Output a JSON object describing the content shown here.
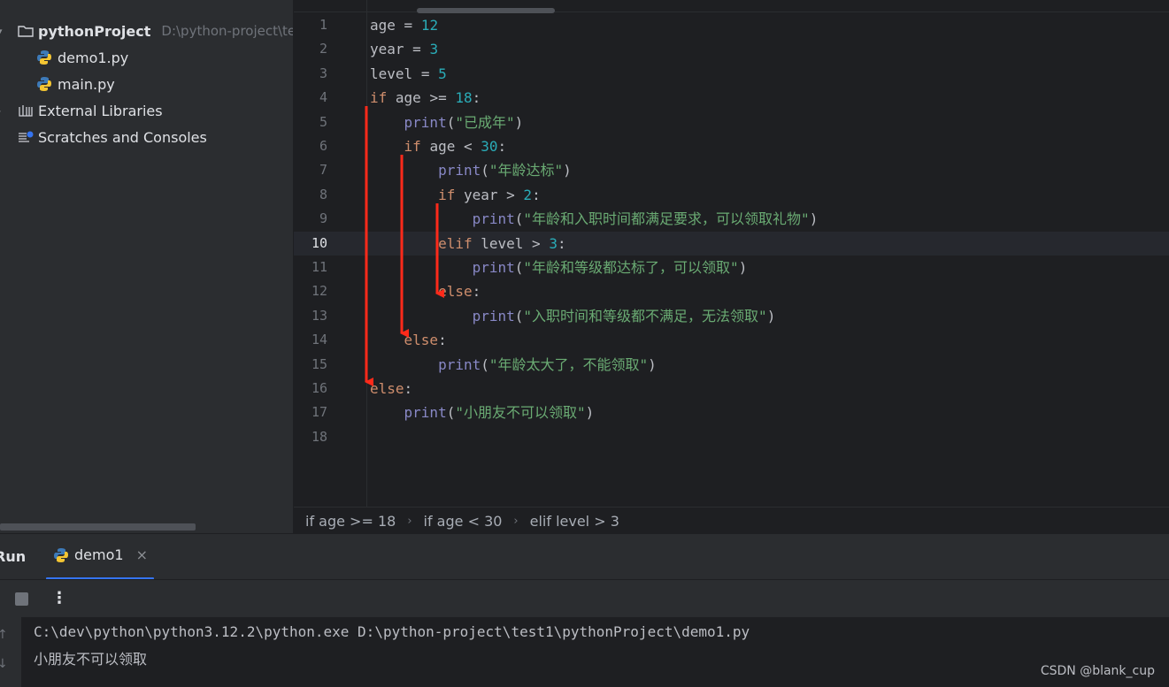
{
  "project": {
    "root_name": "pythonProject",
    "root_path": "D:\\python-project\\te",
    "files": [
      "demo1.py",
      "main.py"
    ],
    "external_libraries": "External Libraries",
    "scratches": "Scratches and Consoles"
  },
  "editor": {
    "current_line": 10,
    "lines": [
      {
        "n": "1",
        "code": "age = 12"
      },
      {
        "n": "2",
        "code": "year = 3"
      },
      {
        "n": "3",
        "code": "level = 5"
      },
      {
        "n": "4",
        "code": "if age >= 18:"
      },
      {
        "n": "5",
        "code": "    print(\"已成年\")"
      },
      {
        "n": "6",
        "code": "    if age < 30:"
      },
      {
        "n": "7",
        "code": "        print(\"年龄达标\")"
      },
      {
        "n": "8",
        "code": "        if year > 2:"
      },
      {
        "n": "9",
        "code": "            print(\"年龄和入职时间都满足要求，可以领取礼物\")"
      },
      {
        "n": "10",
        "code": "        elif level > 3:"
      },
      {
        "n": "11",
        "code": "            print(\"年龄和等级都达标了，可以领取\")"
      },
      {
        "n": "12",
        "code": "        else:"
      },
      {
        "n": "13",
        "code": "            print(\"入职时间和等级都不满足，无法领取\")"
      },
      {
        "n": "14",
        "code": "    else:"
      },
      {
        "n": "15",
        "code": "        print(\"年龄太大了，不能领取\")"
      },
      {
        "n": "16",
        "code": "else:"
      },
      {
        "n": "17",
        "code": "    print(\"小朋友不可以领取\")"
      },
      {
        "n": "18",
        "code": ""
      }
    ]
  },
  "breadcrumb": [
    "if age >= 18",
    "if age < 30",
    "elif level > 3"
  ],
  "run": {
    "title": "Run",
    "tab_label": "demo1",
    "tab_close": "×",
    "more": "⋮",
    "command": "C:\\dev\\python\\python3.12.2\\python.exe D:\\python-project\\test1\\pythonProject\\demo1.py",
    "output": "小朋友不可以领取",
    "up": "↑",
    "down": "↓"
  },
  "watermark": "CSDN @blank_cup",
  "colors": {
    "arrow": "#ff2a1a",
    "keyword": "#cf8e6d",
    "number": "#2aacb8",
    "builtin": "#8888c6",
    "string": "#6aab73"
  }
}
